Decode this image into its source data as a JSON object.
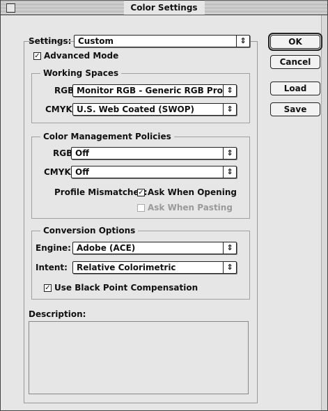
{
  "window": {
    "title": "Color Settings"
  },
  "settings": {
    "label": "Settings:",
    "value": "Custom"
  },
  "advanced_mode": {
    "label": "Advanced Mode",
    "checked": true
  },
  "buttons": {
    "ok": "OK",
    "cancel": "Cancel",
    "load": "Load",
    "save": "Save"
  },
  "working_spaces": {
    "title": "Working Spaces",
    "rgb_label": "RGB:",
    "rgb_value": "Monitor RGB - Generic RGB Profile",
    "cmyk_label": "CMYK:",
    "cmyk_value": "U.S. Web Coated (SWOP)"
  },
  "policies": {
    "title": "Color Management Policies",
    "rgb_label": "RGB:",
    "rgb_value": "Off",
    "cmyk_label": "CMYK:",
    "cmyk_value": "Off",
    "mismatch_label": "Profile Mismatches:",
    "ask_opening": {
      "label": "Ask When Opening",
      "checked": true
    },
    "ask_pasting": {
      "label": "Ask When Pasting",
      "checked": false,
      "enabled": false
    }
  },
  "conversion": {
    "title": "Conversion Options",
    "engine_label": "Engine:",
    "engine_value": "Adobe (ACE)",
    "intent_label": "Intent:",
    "intent_value": "Relative Colorimetric",
    "black_point": {
      "label": "Use Black Point Compensation",
      "checked": true
    }
  },
  "description": {
    "label": "Description:"
  },
  "icons": {
    "popup_arrow": "⇕",
    "check": "✓"
  }
}
